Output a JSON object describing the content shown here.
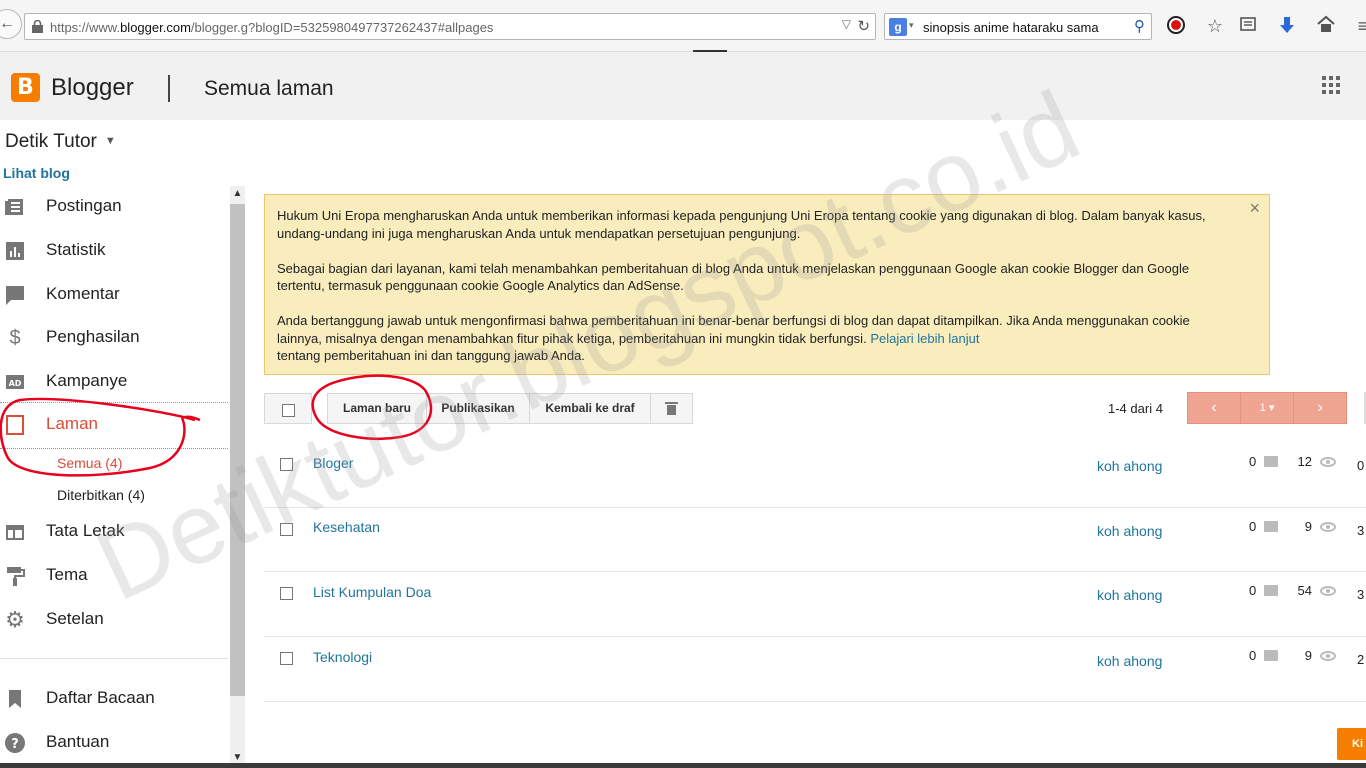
{
  "browser": {
    "url_prefix": "https://www.",
    "url_host": "blogger.com",
    "url_path": "/blogger.g?blogID=5325980497737262437#allpages",
    "search_query": "sinopsis anime hataraku sama"
  },
  "header": {
    "app_name": "Blogger",
    "page_title": "Semua laman"
  },
  "sidebar": {
    "blog_name": "Detik Tutor",
    "view_blog": "Lihat blog",
    "items": [
      {
        "label": "Postingan"
      },
      {
        "label": "Statistik"
      },
      {
        "label": "Komentar"
      },
      {
        "label": "Penghasilan"
      },
      {
        "label": "Kampanye"
      },
      {
        "label": "Laman"
      },
      {
        "label": "Tata Letak"
      },
      {
        "label": "Tema"
      },
      {
        "label": "Setelan"
      },
      {
        "label": "Daftar Bacaan"
      },
      {
        "label": "Bantuan"
      }
    ],
    "sub_items": [
      {
        "label": "Semua (4)"
      },
      {
        "label": "Diterbitkan (4)"
      }
    ]
  },
  "notice": {
    "p1": "Hukum Uni Eropa mengharuskan Anda untuk memberikan informasi kepada pengunjung Uni Eropa tentang cookie yang digunakan di blog. Dalam banyak kasus, undang-undang ini juga mengharuskan Anda untuk mendapatkan persetujuan pengunjung.",
    "p2": "Sebagai bagian dari layanan, kami telah menambahkan pemberitahuan di blog Anda untuk menjelaskan penggunaan Google akan cookie Blogger dan Google tertentu, termasuk penggunaan cookie Google Analytics dan AdSense.",
    "p3": "Anda bertanggung jawab untuk mengonfirmasi bahwa pemberitahuan ini benar-benar berfungsi di blog dan dapat ditampilkan. Jika Anda menggunakan cookie lainnya, misalnya dengan menambahkan fitur pihak ketiga, pemberitahuan ini mungkin tidak berfungsi.",
    "link": "Pelajari lebih lanjut",
    "p3_tail": "tentang pemberitahuan ini dan tanggung jawab Anda.",
    "close": "×"
  },
  "toolbar": {
    "new_page": "Laman baru",
    "publish": "Publikasikan",
    "revert": "Kembali ke draf"
  },
  "pager": {
    "range": "1-4 dari 4",
    "prev": "‹",
    "page": "1 ▾",
    "next": "›"
  },
  "pages": [
    {
      "title": "Bloger",
      "author": "koh ahong",
      "comments": "0",
      "views": "12",
      "extra": "0"
    },
    {
      "title": "Kesehatan",
      "author": "koh ahong",
      "comments": "0",
      "views": "9",
      "extra": "3"
    },
    {
      "title": "List Kumpulan Doa",
      "author": "koh ahong",
      "comments": "0",
      "views": "54",
      "extra": "3"
    },
    {
      "title": "Teknologi",
      "author": "koh ahong",
      "comments": "0",
      "views": "9",
      "extra": "2"
    }
  ],
  "floating_button": "Ki",
  "watermark": "Detiktutor.blogspot.co.id",
  "colors": {
    "accent": "#dd4b39",
    "link": "#21759b",
    "brand": "#f57d00",
    "notice_bg": "#f9edbe",
    "annotation": "#e8001c"
  }
}
